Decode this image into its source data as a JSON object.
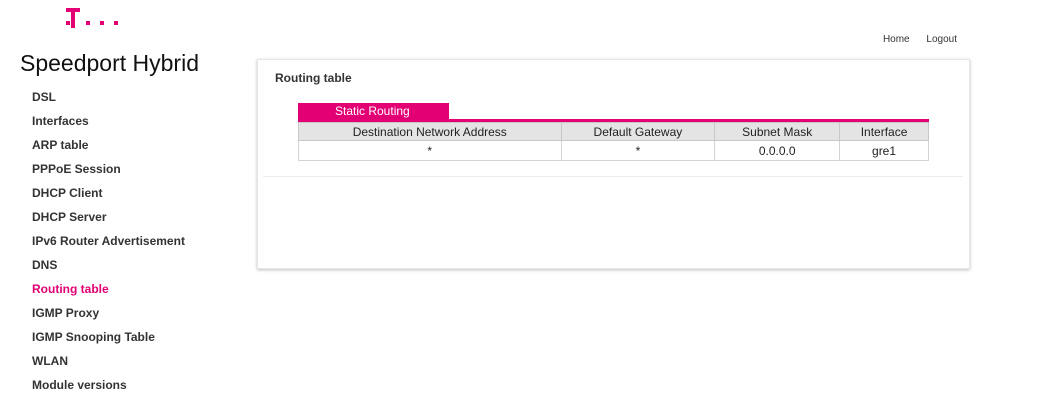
{
  "brand": {
    "logo_icon": "telekom-t-logo-icon",
    "logo_color": "#e20074",
    "title": "Speedport Hybrid"
  },
  "topnav": {
    "home": "Home",
    "logout": "Logout"
  },
  "sidebar": {
    "items": [
      {
        "label": "DSL"
      },
      {
        "label": "Interfaces"
      },
      {
        "label": "ARP table"
      },
      {
        "label": "PPPoE Session"
      },
      {
        "label": "DHCP Client"
      },
      {
        "label": "DHCP Server"
      },
      {
        "label": "IPv6 Router Advertisement"
      },
      {
        "label": "DNS"
      },
      {
        "label": "Routing table"
      },
      {
        "label": "IGMP Proxy"
      },
      {
        "label": "IGMP Snooping Table"
      },
      {
        "label": "WLAN"
      },
      {
        "label": "Module versions"
      }
    ],
    "active": "Routing table"
  },
  "main": {
    "title": "Routing table",
    "tab": "Static Routing",
    "table": {
      "headers": [
        "Destination Network Address",
        "Default Gateway",
        "Subnet Mask",
        "Interface"
      ],
      "rows": [
        [
          "*",
          "*",
          "0.0.0.0",
          "gre1"
        ]
      ]
    }
  },
  "colors": {
    "accent": "#e20074",
    "header_bg": "#e4e4e4"
  }
}
